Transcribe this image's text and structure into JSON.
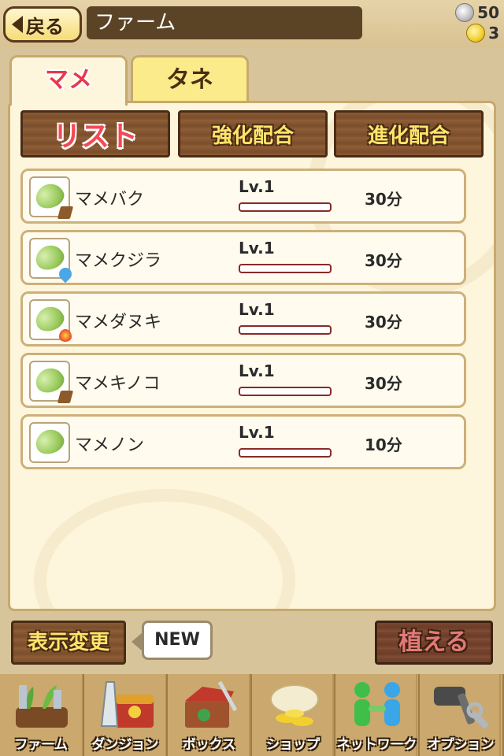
{
  "header": {
    "back_label": "戻る",
    "title": "ファーム",
    "coins": "50",
    "gold": "3"
  },
  "tabs": [
    {
      "label": "マメ",
      "active": true
    },
    {
      "label": "タネ",
      "active": false
    }
  ],
  "subnav": {
    "list_label": "リスト",
    "enhance_label": "強化配合",
    "evolve_label": "進化配合"
  },
  "items": [
    {
      "name": "マメバク",
      "level": "Lv.1",
      "time": "30分",
      "element": "wood-icon",
      "exp": 0
    },
    {
      "name": "マメクジラ",
      "level": "Lv.1",
      "time": "30分",
      "element": "water-drop-icon",
      "exp": 0
    },
    {
      "name": "マメダヌキ",
      "level": "Lv.1",
      "time": "30分",
      "element": "fire-icon",
      "exp": 0
    },
    {
      "name": "マメキノコ",
      "level": "Lv.1",
      "time": "30分",
      "element": "wood-icon",
      "exp": 0
    },
    {
      "name": "マメノン",
      "level": "Lv.1",
      "time": "10分",
      "element": "none",
      "exp": 0
    }
  ],
  "footer_actions": {
    "display_change_label": "表示変更",
    "new_badge": "NEW",
    "plant_label": "植える"
  },
  "nav": [
    {
      "label": "ファーム",
      "icon": "farm-icon"
    },
    {
      "label": "ダンジョン",
      "icon": "dungeon-icon"
    },
    {
      "label": "ボックス",
      "icon": "box-icon"
    },
    {
      "label": "ショップ",
      "icon": "shop-icon"
    },
    {
      "label": "ネットワーク",
      "icon": "network-icon"
    },
    {
      "label": "オプション",
      "icon": "options-icon"
    }
  ],
  "colors": {
    "accent_red": "#e8394a",
    "wood": "#7a4e2c",
    "panel_bg": "#fdf6dc",
    "tab_tane_bg": "#fbeb8a"
  }
}
